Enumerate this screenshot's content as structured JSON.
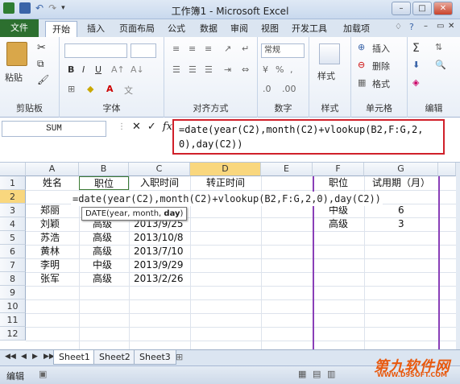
{
  "window": {
    "title": "工作簿1 - Microsoft Excel"
  },
  "ribbon_tabs": [
    "文件",
    "开始",
    "插入",
    "页面布局",
    "公式",
    "数据",
    "审阅",
    "视图",
    "开发工具",
    "加载项"
  ],
  "ribbon": {
    "clipboard": {
      "label": "剪贴板",
      "paste": "粘贴"
    },
    "font": {
      "label": "字体",
      "bold": "B",
      "italic": "I",
      "underline": "U"
    },
    "alignment": {
      "label": "对齐方式"
    },
    "number": {
      "label": "数字",
      "format": "常规",
      "percent": "%"
    },
    "styles": {
      "label": "样式"
    },
    "cells": {
      "label": "单元格",
      "insert": "插入",
      "delete": "删除",
      "format": "格式"
    },
    "editing": {
      "label": "编辑",
      "sum": "Σ"
    }
  },
  "formula_bar": {
    "name_box": "SUM",
    "cancel": "✕",
    "enter": "✓",
    "fx": "fx",
    "formula": "=date(year(C2),month(C2)+vlookup(B2,F:G,2,0),day(C2))"
  },
  "grid": {
    "columns": [
      "A",
      "B",
      "C",
      "D",
      "E",
      "F",
      "G"
    ],
    "rows": [
      "1",
      "2",
      "3",
      "4",
      "5",
      "6",
      "7",
      "8",
      "9",
      "10",
      "11",
      "12"
    ],
    "headers": {
      "A1": "姓名",
      "B1": "职位",
      "C1": "入职时间",
      "D1": "转正时间",
      "F1": "职位",
      "G1": "试用期（月）"
    },
    "editing_cell": "=date(year(C2),month(C2)+vlookup(B2,F:G,2,0),day(C2))",
    "tooltip": {
      "prefix": "DATE(year, month, ",
      "current_arg": "day",
      "suffix": ")"
    },
    "data": [
      {
        "name": "郑丽",
        "pos": "",
        "date": "2013/9/25"
      },
      {
        "name": "刘颖",
        "pos": "高级",
        "date": "2013/9/25"
      },
      {
        "name": "苏浩",
        "pos": "高级",
        "date": "2013/10/8"
      },
      {
        "name": "黄林",
        "pos": "高级",
        "date": "2013/7/10"
      },
      {
        "name": "李明",
        "pos": "中级",
        "date": "2013/9/29"
      },
      {
        "name": "张军",
        "pos": "高级",
        "date": "2013/2/26"
      }
    ],
    "lookup": [
      {
        "pos": "中级",
        "months": "6"
      },
      {
        "pos": "高级",
        "months": "3"
      }
    ]
  },
  "sheet_tabs": [
    "Sheet1",
    "Sheet2",
    "Sheet3"
  ],
  "status": {
    "mode": "编辑",
    "watermark": "第九软件网",
    "watermark_url": "WWW.D9SOFT.COM"
  }
}
